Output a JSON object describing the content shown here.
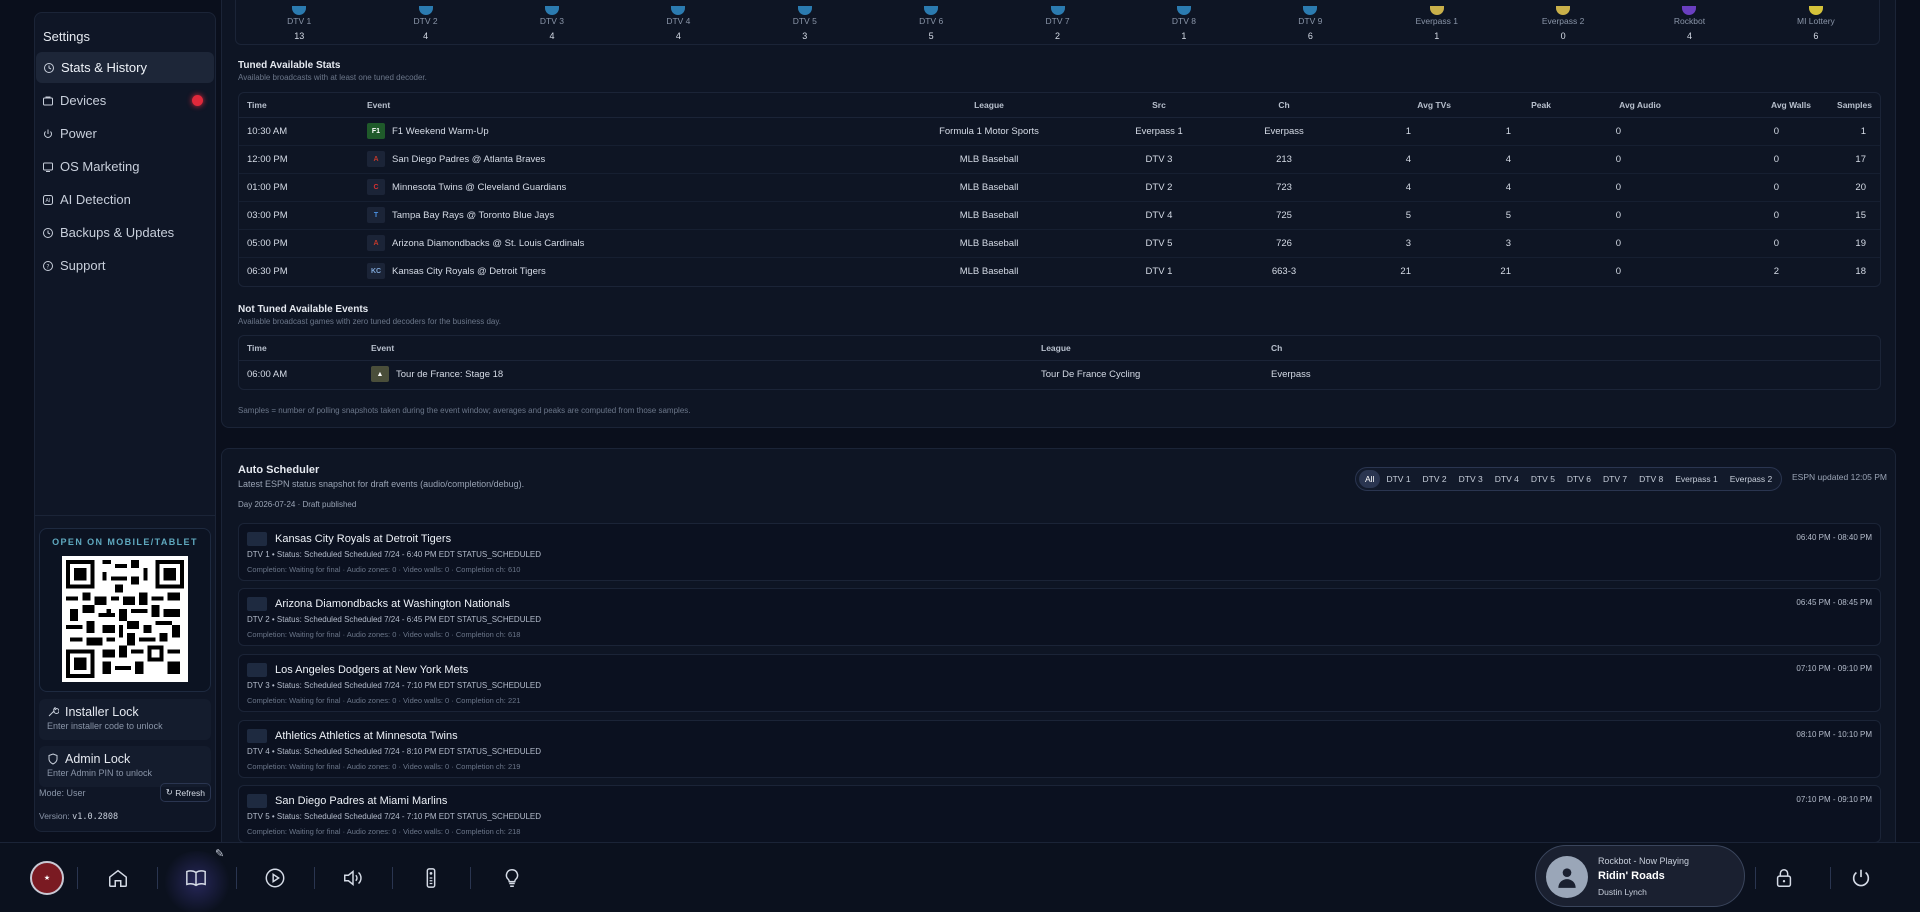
{
  "sidebar": {
    "title": "Settings",
    "items": [
      {
        "label": "Stats & History",
        "icon": "history-icon"
      },
      {
        "label": "Devices",
        "icon": "devices-icon"
      },
      {
        "label": "Power",
        "icon": "power-icon"
      },
      {
        "label": "OS Marketing",
        "icon": "marketing-icon"
      },
      {
        "label": "AI Detection",
        "icon": "ai-icon"
      },
      {
        "label": "Backups & Updates",
        "icon": "backup-icon"
      },
      {
        "label": "Support",
        "icon": "help-icon"
      }
    ],
    "qr_label": "OPEN ON MOBILE/TABLET",
    "installer_lock": {
      "title": "Installer Lock",
      "sub": "Enter installer code to unlock"
    },
    "admin_lock": {
      "title": "Admin Lock",
      "sub": "Enter Admin PIN to unlock"
    },
    "mode_text": "Mode: User",
    "refresh_label": "Refresh",
    "version_label": "Version:",
    "version_value": "v1.0.2808"
  },
  "dtv_strip": [
    {
      "name": "DTV 1",
      "count": "13"
    },
    {
      "name": "DTV 2",
      "count": "4"
    },
    {
      "name": "DTV 3",
      "count": "4"
    },
    {
      "name": "DTV 4",
      "count": "4"
    },
    {
      "name": "DTV 5",
      "count": "3"
    },
    {
      "name": "DTV 6",
      "count": "5"
    },
    {
      "name": "DTV 7",
      "count": "2"
    },
    {
      "name": "DTV 8",
      "count": "1"
    },
    {
      "name": "DTV 9",
      "count": "6"
    },
    {
      "name": "Everpass 1",
      "count": "1"
    },
    {
      "name": "Everpass 2",
      "count": "0"
    },
    {
      "name": "Rockbot",
      "count": "4"
    },
    {
      "name": "MI Lottery",
      "count": "6"
    }
  ],
  "tuned": {
    "title": "Tuned Available Stats",
    "sub": "Available broadcasts with at least one tuned decoder.",
    "headers": [
      "Time",
      "Event",
      "League",
      "Src",
      "Ch",
      "Avg TVs",
      "Peak",
      "Avg Audio",
      "Avg Walls",
      "Samples"
    ],
    "rows": [
      [
        "10:30 AM",
        "F1 Weekend Warm-Up",
        "Formula 1 Motor Sports",
        "Everpass 1",
        "Everpass",
        "1",
        "1",
        "0",
        "0",
        "1"
      ],
      [
        "12:00 PM",
        "San Diego Padres @ Atlanta Braves",
        "MLB Baseball",
        "DTV 3",
        "213",
        "4",
        "4",
        "0",
        "0",
        "17"
      ],
      [
        "01:00 PM",
        "Minnesota Twins @ Cleveland Guardians",
        "MLB Baseball",
        "DTV 2",
        "723",
        "4",
        "4",
        "0",
        "0",
        "20"
      ],
      [
        "03:00 PM",
        "Tampa Bay Rays @ Toronto Blue Jays",
        "MLB Baseball",
        "DTV 4",
        "725",
        "5",
        "5",
        "0",
        "0",
        "15"
      ],
      [
        "05:00 PM",
        "Arizona Diamondbacks @ St. Louis Cardinals",
        "MLB Baseball",
        "DTV 5",
        "726",
        "3",
        "3",
        "0",
        "0",
        "19"
      ],
      [
        "06:30 PM",
        "Kansas City Royals @ Detroit Tigers",
        "MLB Baseball",
        "DTV 1",
        "663-3",
        "21",
        "21",
        "0",
        "2",
        "18"
      ]
    ]
  },
  "not_tuned": {
    "title": "Not Tuned Available Events",
    "sub": "Available broadcast games with zero tuned decoders for the business day.",
    "headers": [
      "Time",
      "Event",
      "League",
      "Ch"
    ],
    "rows": [
      [
        "06:00 AM",
        "Tour de France: Stage 18",
        "Tour De France Cycling",
        "Everpass"
      ]
    ]
  },
  "footnote": "Samples = number of polling snapshots taken during the event window; averages and peaks are computed from those samples.",
  "scheduler": {
    "title": "Auto Scheduler",
    "sub": "Latest ESPN status snapshot for draft events (audio/completion/debug).",
    "day": "Day 2026-07-24 · Draft published",
    "filters": [
      "All",
      "DTV 1",
      "DTV 2",
      "DTV 3",
      "DTV 4",
      "DTV 5",
      "DTV 6",
      "DTV 7",
      "DTV 8",
      "Everpass 1",
      "Everpass 2"
    ],
    "espn_updated": "ESPN updated 12:05 PM",
    "games": [
      {
        "title": "Kansas City Royals at Detroit Tigers",
        "status": "DTV 1 • Status: Scheduled Scheduled 7/24 - 6:40 PM EDT STATUS_SCHEDULED",
        "completion": "Completion: Waiting for final · Audio zones: 0 · Video walls: 0 · Completion ch: 610",
        "time": "06:40 PM - 08:40 PM"
      },
      {
        "title": "Arizona Diamondbacks at Washington Nationals",
        "status": "DTV 2 • Status: Scheduled Scheduled 7/24 - 6:45 PM EDT STATUS_SCHEDULED",
        "completion": "Completion: Waiting for final · Audio zones: 0 · Video walls: 0 · Completion ch: 618",
        "time": "06:45 PM - 08:45 PM"
      },
      {
        "title": "Los Angeles Dodgers at New York Mets",
        "status": "DTV 3 • Status: Scheduled Scheduled 7/24 - 7:10 PM EDT STATUS_SCHEDULED",
        "completion": "Completion: Waiting for final · Audio zones: 0 · Video walls: 0 · Completion ch: 221",
        "time": "07:10 PM - 09:10 PM"
      },
      {
        "title": "Athletics Athletics at Minnesota Twins",
        "status": "DTV 4 • Status: Scheduled Scheduled 7/24 - 8:10 PM EDT STATUS_SCHEDULED",
        "completion": "Completion: Waiting for final · Audio zones: 0 · Video walls: 0 · Completion ch: 219",
        "time": "08:10 PM - 10:10 PM"
      },
      {
        "title": "San Diego Padres at Miami Marlins",
        "status": "DTV 5 • Status: Scheduled Scheduled 7/24 - 7:10 PM EDT STATUS_SCHEDULED",
        "completion": "Completion: Waiting for final · Audio zones: 0 · Video walls: 0 · Completion ch: 218",
        "time": "07:10 PM - 09:10 PM"
      }
    ]
  },
  "now_playing": {
    "source": "Rockbot - Now Playing",
    "track": "Ridin' Roads",
    "artist": "Dustin Lynch"
  },
  "bottombar": {
    "icons": [
      "logo-icon",
      "home-icon",
      "book-icon",
      "play-icon",
      "volume-icon",
      "remote-icon",
      "lightbulb-icon",
      "lock-icon",
      "power-icon"
    ]
  },
  "colors": {
    "background": "#0a0f1c",
    "panel": "#0e1524",
    "accent_blue": "#2b7bb0",
    "alert_red": "#e0293b"
  }
}
